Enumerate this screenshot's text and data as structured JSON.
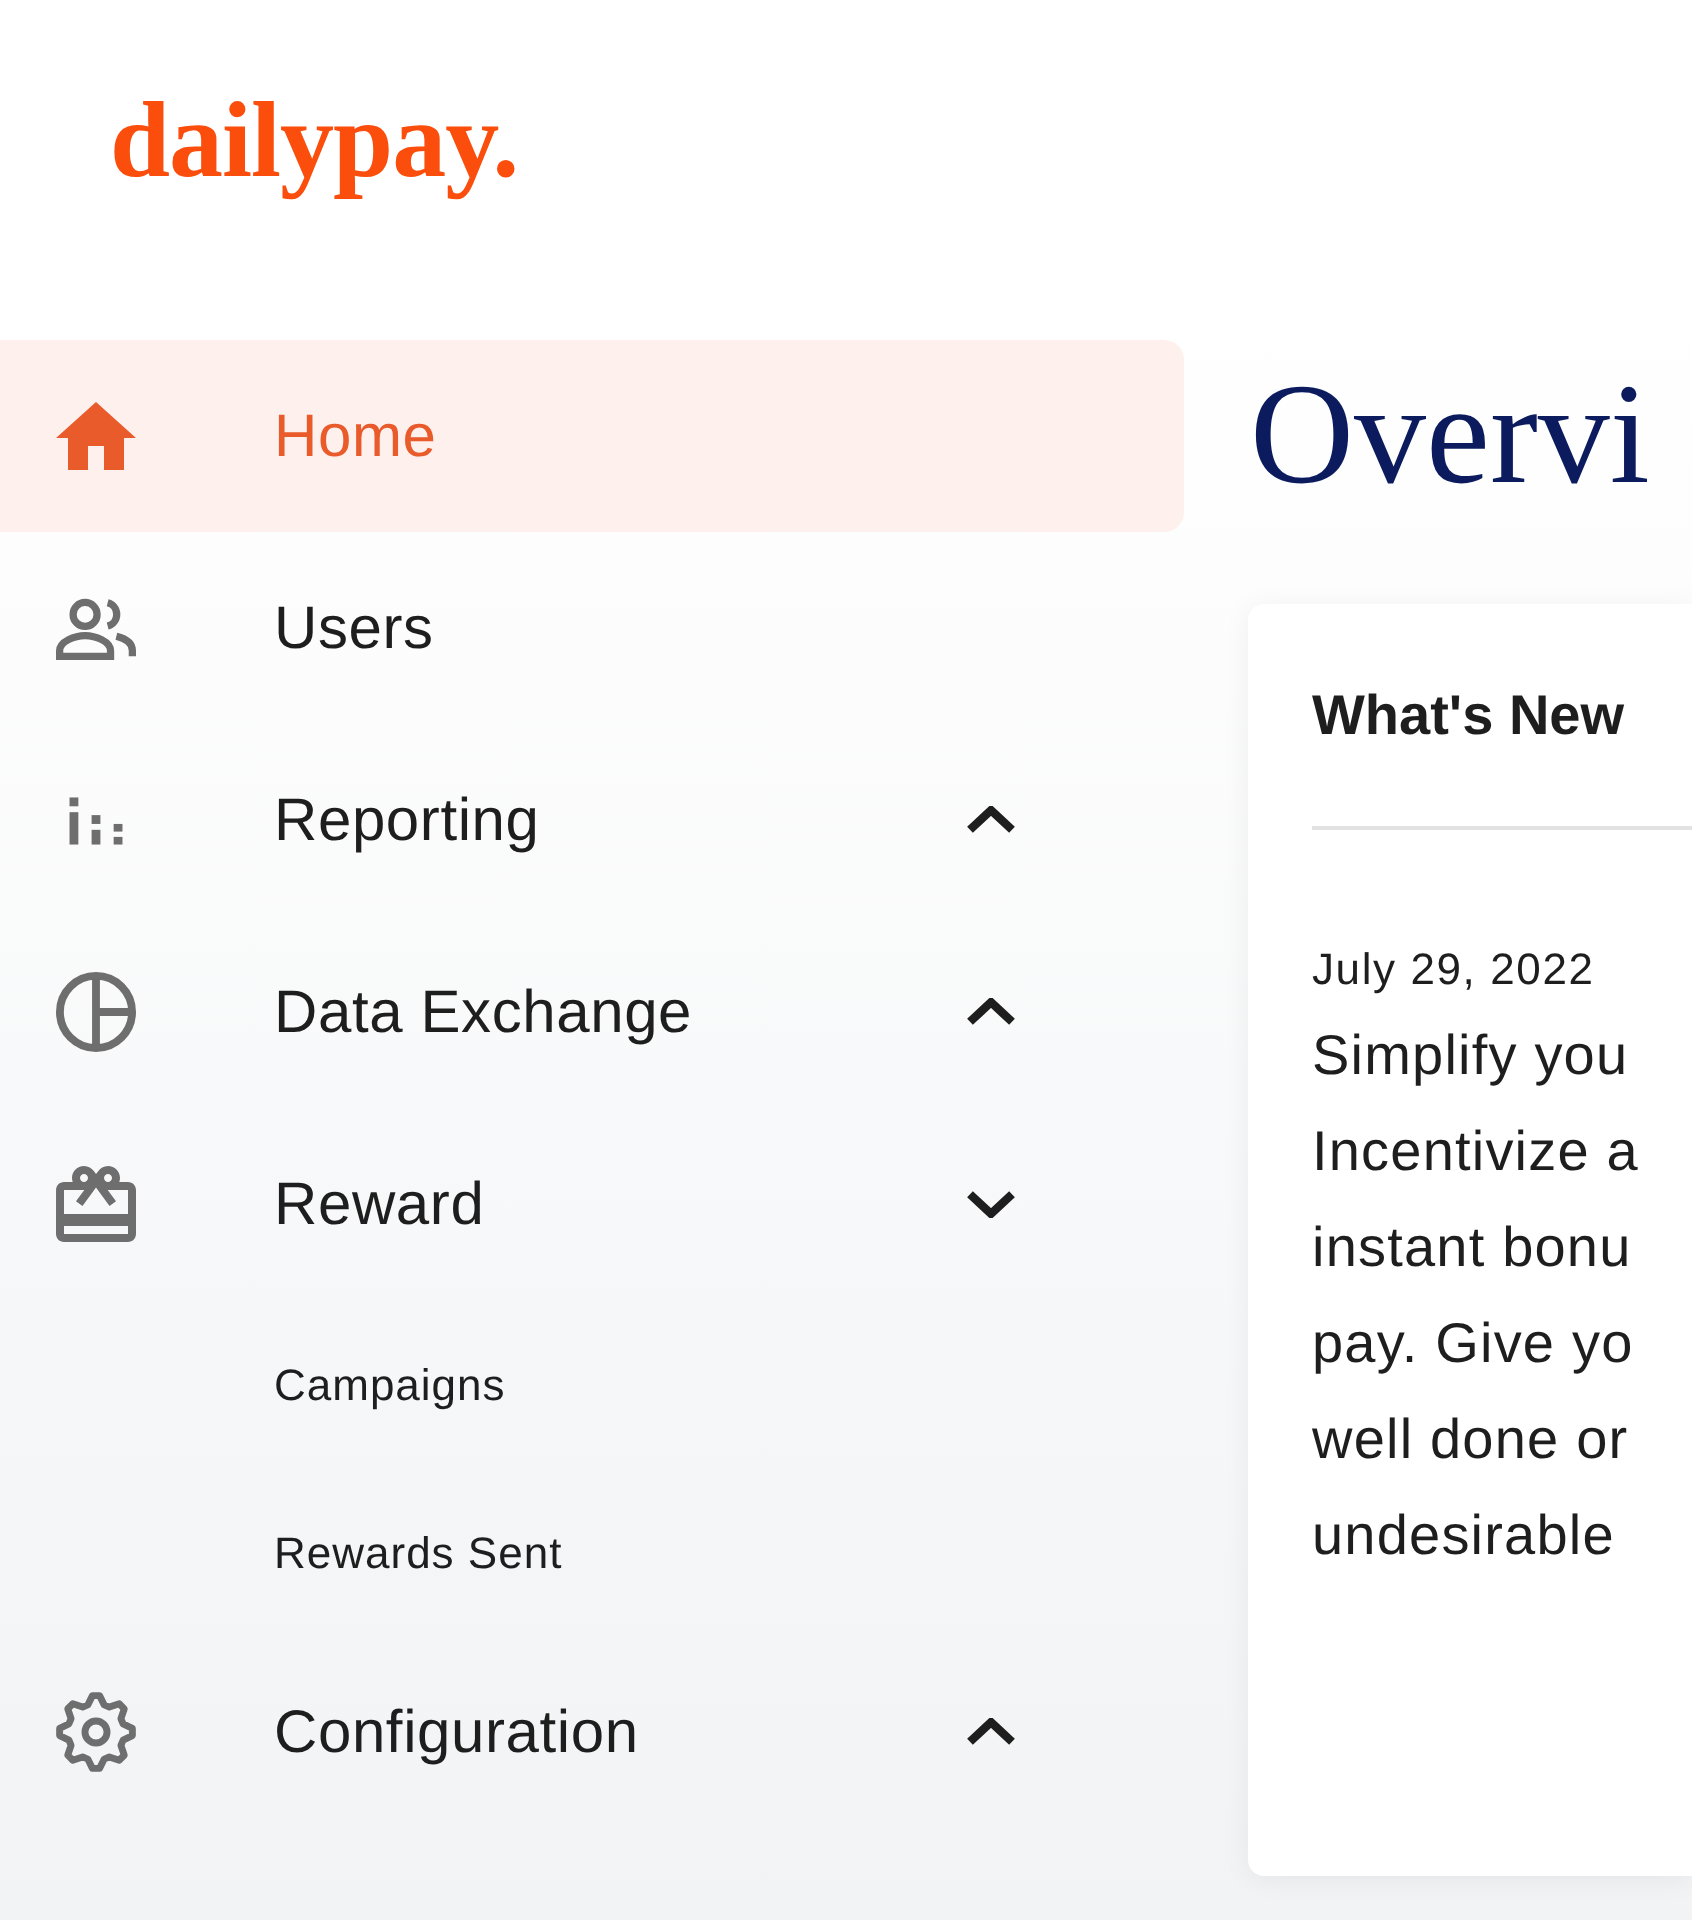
{
  "logo": "dailypay.",
  "sidebar": {
    "items": [
      {
        "label": "Home",
        "selected": true
      },
      {
        "label": "Users",
        "selected": false
      },
      {
        "label": "Reporting",
        "selected": false,
        "expanded": false
      },
      {
        "label": "Data Exchange",
        "selected": false,
        "expanded": false
      },
      {
        "label": "Reward",
        "selected": false,
        "expanded": true,
        "children": [
          {
            "label": "Campaigns",
            "selected": false
          },
          {
            "label": "Rewards Sent",
            "selected": false
          }
        ]
      },
      {
        "label": "Configuration",
        "selected": false,
        "expanded": false
      }
    ]
  },
  "main": {
    "title": "Overvi",
    "card": {
      "title": "What's New",
      "date": "July 29, 2022",
      "text": "Simplify you\nIncentivize a\ninstant bonu\npay. Give yo\nwell done or\nundesirable"
    }
  }
}
